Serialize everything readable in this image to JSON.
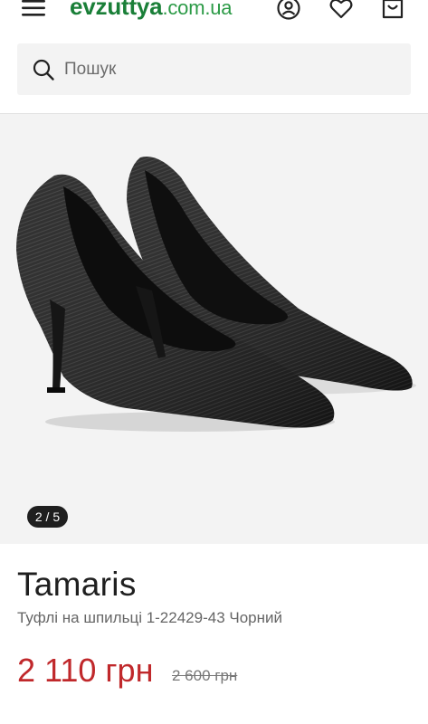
{
  "header": {
    "logo": {
      "brand": "evzuttya",
      "tld": ".com.ua"
    },
    "icons": [
      "menu-icon",
      "account-icon",
      "heart-icon",
      "cart-icon"
    ]
  },
  "search": {
    "placeholder": "Пошук",
    "value": ""
  },
  "gallery": {
    "counter": "2 / 5"
  },
  "product": {
    "brand": "Tamaris",
    "title": "Туфлі на шпильці 1-22429-43 Чорний",
    "price": "2 110 грн",
    "old_price": "2 600 грн"
  },
  "colors": {
    "brand_green": "#1a7f38",
    "price_red": "#c0282b",
    "gallery_bg": "#f3f3f3"
  }
}
